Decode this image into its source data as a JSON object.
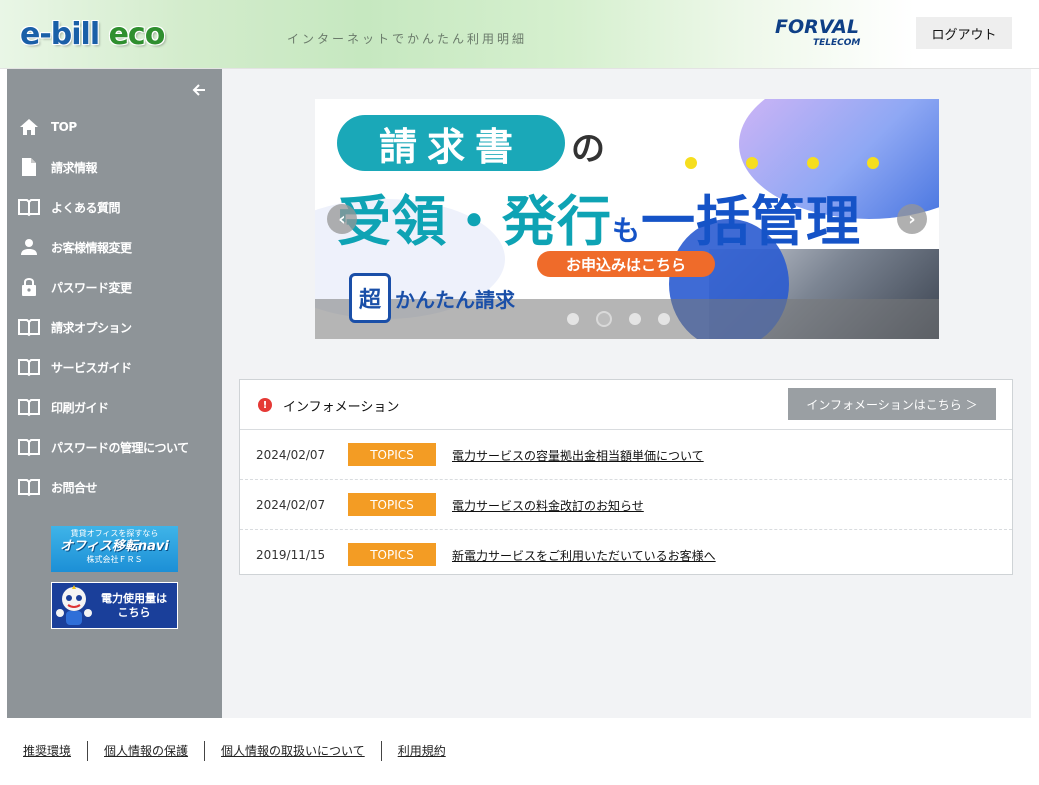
{
  "header": {
    "logo_main": "e-bill",
    "logo_eco": "eco",
    "tagline": "インターネットでかんたん利用明細",
    "brand_name": "FORVAL",
    "brand_sub": "TELECOM",
    "logout_label": "ログアウト"
  },
  "sidebar": {
    "items": [
      {
        "label": "TOP",
        "icon": "home-icon"
      },
      {
        "label": "請求情報",
        "icon": "document-icon"
      },
      {
        "label": "よくある質問",
        "icon": "book-icon"
      },
      {
        "label": "お客様情報変更",
        "icon": "person-icon"
      },
      {
        "label": "パスワード変更",
        "icon": "lock-icon"
      },
      {
        "label": "請求オプション",
        "icon": "book-icon"
      },
      {
        "label": "サービスガイド",
        "icon": "book-icon"
      },
      {
        "label": "印刷ガイド",
        "icon": "book-icon"
      },
      {
        "label": "パスワードの管理について",
        "icon": "book-icon"
      },
      {
        "label": "お問合せ",
        "icon": "book-icon"
      }
    ],
    "banner_office": {
      "line1": "賃貸オフィスを探すなら",
      "line2": "オフィス移転navi",
      "line3": "株式会社ＦＲＳ"
    },
    "banner_power": {
      "line1": "電力使用量は",
      "line2": "こちら"
    }
  },
  "carousel": {
    "pill_text": "請求書",
    "particle": "の",
    "main_part1": "受領・発行",
    "main_small": "も",
    "main_part2": "一括管理",
    "cta": "お申込みはこちら",
    "brand_mark": "超",
    "brand_text": "かんたん請求",
    "slide_count": 4,
    "active_slide": 2
  },
  "info": {
    "title": "インフォメーション",
    "more_label": "インフォメーションはこちら ＞",
    "rows": [
      {
        "date": "2024/02/07",
        "badge": "TOPICS",
        "text": "電力サービスの容量拠出金相当額単価について"
      },
      {
        "date": "2024/02/07",
        "badge": "TOPICS",
        "text": "電力サービスの料金改訂のお知らせ"
      },
      {
        "date": "2019/11/15",
        "badge": "TOPICS",
        "text": "新電力サービスをご利用いただいているお客様へ"
      }
    ]
  },
  "footer": {
    "links": [
      "推奨環境",
      "個人情報の保護",
      "個人情報の取扱いについて",
      "利用規約"
    ]
  },
  "colors": {
    "sidebar_bg": "#8e9498",
    "main_bg": "#f2f3f5",
    "topics_badge": "#f39c24",
    "info_icon": "#e53935",
    "more_button": "#9a9fa3"
  }
}
